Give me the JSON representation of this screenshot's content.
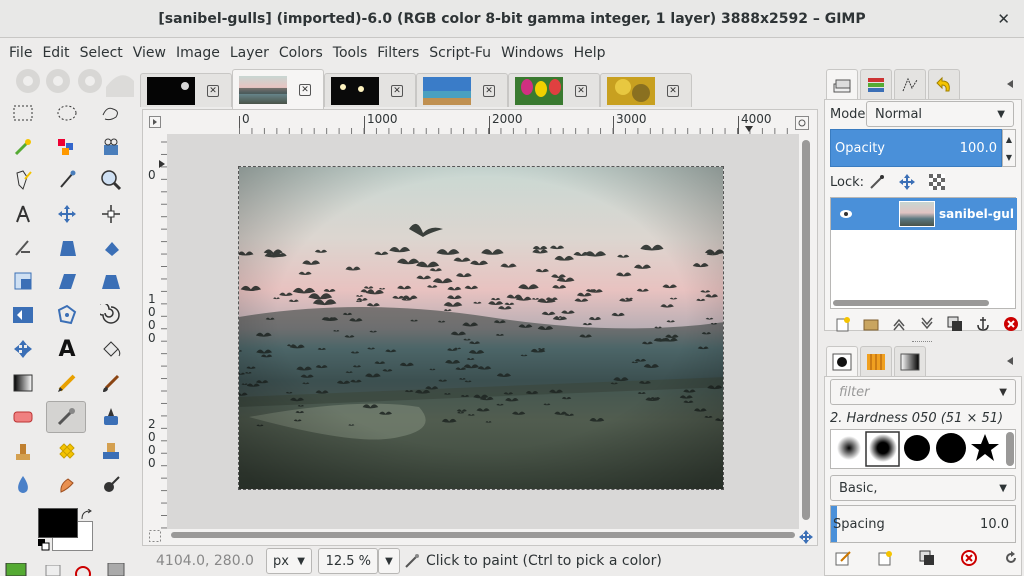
{
  "window": {
    "title": "[sanibel-gulls] (imported)-6.0 (RGB color 8-bit gamma integer, 1 layer) 3888x2592 – GIMP"
  },
  "menu": [
    "File",
    "Edit",
    "Select",
    "View",
    "Image",
    "Layer",
    "Colors",
    "Tools",
    "Filters",
    "Script-Fu",
    "Windows",
    "Help"
  ],
  "ruler": {
    "h": [
      "0",
      "1000",
      "2000",
      "3000",
      "4000"
    ],
    "v": [
      "0",
      "1000",
      "2000"
    ]
  },
  "status": {
    "coords": "4104.0, 280.0",
    "unit": "px",
    "zoom": "12.5 %",
    "message": "Click to paint (Ctrl to pick a color)"
  },
  "layers": {
    "mode_label": "Mode:",
    "mode": "Normal",
    "opacity_label": "Opacity",
    "opacity": "100.0",
    "lock_label": "Lock:",
    "layer_name": "sanibel-gulls"
  },
  "brushes": {
    "filter_placeholder": "filter",
    "selected": "2. Hardness 050 (51 × 51)",
    "tag": "Basic,",
    "spacing_label": "Spacing",
    "spacing": "10.0"
  },
  "colors": {
    "accent": "#4a90d9",
    "fg": "#000000",
    "bg": "#ffffff"
  }
}
